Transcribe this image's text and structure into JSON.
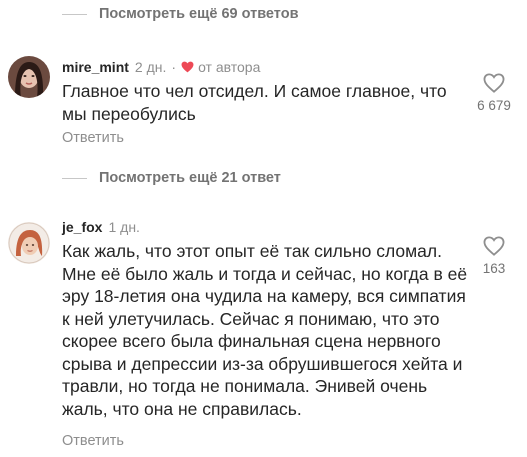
{
  "threads": [
    {
      "more_replies": "Посмотреть ещё 69 ответов"
    },
    {
      "more_replies": "Посмотреть ещё 21 ответ"
    }
  ],
  "comments": [
    {
      "username": "mire_mint",
      "time": "2 дн.",
      "separator": "·",
      "author_like": "от автора",
      "text": "Главное что чел отсидел. И самое главное, что мы переобулись",
      "likes": "6 679",
      "reply": "Ответить"
    },
    {
      "username": "je_fox",
      "time": "1 дн.",
      "text": "Как жаль, что этот опыт её так сильно сломал. Мне её было жаль и тогда и сейчас, но когда в её эру 18-летия она чудила на камеру, вся симпатия к ней улетучилась. Сейчас я понимаю, что это скорее всего была финальная сцена нервного срыва и депрессии из-за обрушившегося хейта и травли, но тогда не понимала. Энивей очень жаль, что она не справилась.",
      "likes": "163",
      "reply": "Ответить"
    }
  ],
  "colors": {
    "heart_red": "#ed4956",
    "muted": "#8e8e8e",
    "text": "#262626"
  }
}
